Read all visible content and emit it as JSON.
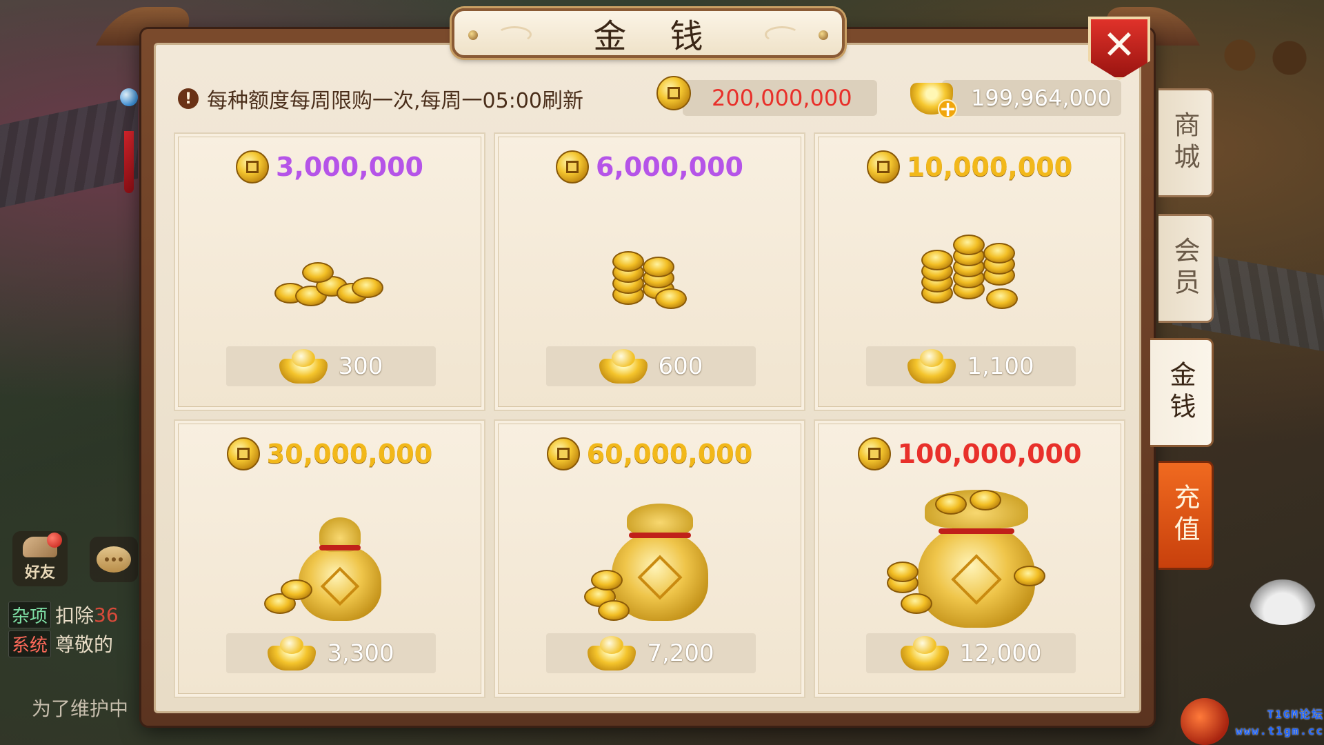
{
  "dialog": {
    "title": "金 钱",
    "close_label": "✕",
    "notice_icon": "!",
    "notice": "每种额度每周限购一次,每周一05:00刷新",
    "balances": {
      "money": "200,000,000",
      "gold": "199,964,000"
    }
  },
  "packages": [
    {
      "amount": "3,000,000",
      "price": "300",
      "amount_color": "#b554e8"
    },
    {
      "amount": "6,000,000",
      "price": "600",
      "amount_color": "#b554e8"
    },
    {
      "amount": "10,000,000",
      "price": "1,100",
      "amount_color": "#f2b81a"
    },
    {
      "amount": "30,000,000",
      "price": "3,300",
      "amount_color": "#f2b81a"
    },
    {
      "amount": "60,000,000",
      "price": "7,200",
      "amount_color": "#f2b81a"
    },
    {
      "amount": "100,000,000",
      "price": "12,000",
      "amount_color": "#e8302a"
    }
  ],
  "side_tabs": [
    {
      "label": "商城",
      "active": false
    },
    {
      "label": "会员",
      "active": false
    },
    {
      "label": "金钱",
      "active": true
    },
    {
      "label": "充值",
      "active": false
    }
  ],
  "hud": {
    "friend_label": "好友",
    "chat": [
      {
        "tag": "杂项",
        "text": "扣除",
        "extra": "36"
      },
      {
        "tag": "系统",
        "text": "尊敬的"
      }
    ],
    "maintenance": "为了维护中",
    "watermark": [
      "T1GM论坛",
      "www.t1gm.cc"
    ]
  },
  "colors": {
    "accent_red": "#e8302a",
    "purple_amount": "#b554e8",
    "gold_amount": "#f2b81a",
    "active_tab": "#e05a18"
  },
  "icons": {
    "coin": "copper-coin-icon",
    "gold": "gold-ingot-icon",
    "close": "close-icon",
    "notice": "exclamation-icon"
  }
}
